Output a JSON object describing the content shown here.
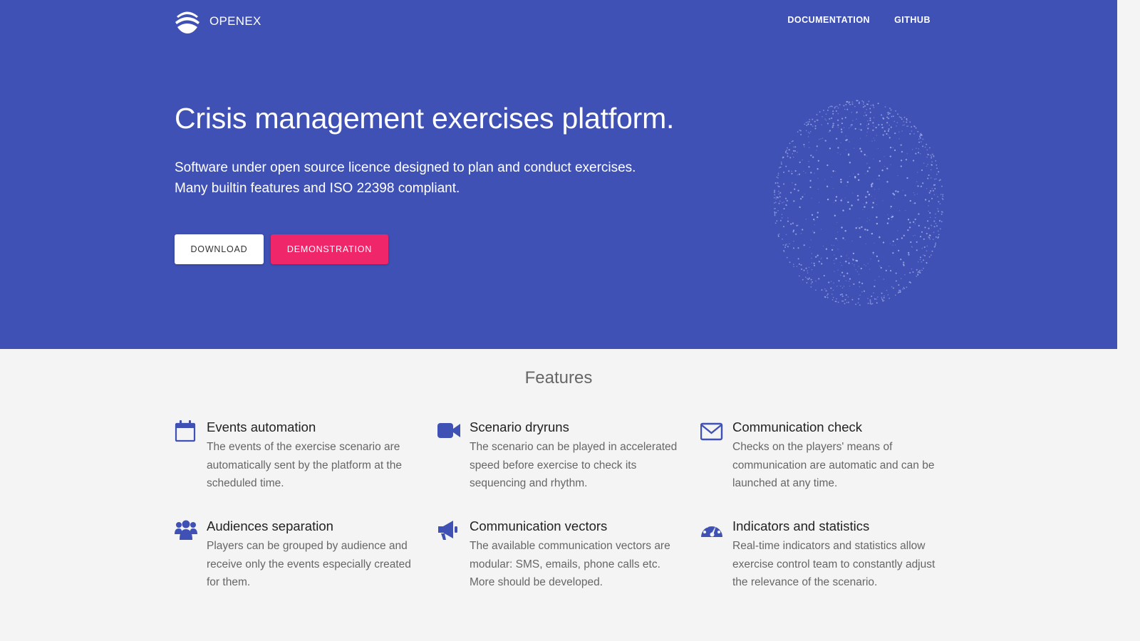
{
  "header": {
    "logo_text": "OPENEX",
    "nav": [
      "DOCUMENTATION",
      "GITHUB"
    ]
  },
  "hero": {
    "title": "Crisis management exercises platform.",
    "subtitle_line1": "Software under open source licence designed to plan and conduct exercises.",
    "subtitle_line2": "Many builtin features and ISO 22398 compliant.",
    "download_label": "DOWNLOAD",
    "demo_label": "DEMONSTRATION"
  },
  "features": {
    "title": "Features",
    "items": [
      {
        "icon": "calendar-icon",
        "title": "Events automation",
        "text": "The events of the exercise scenario are automatically sent by the platform at the scheduled time."
      },
      {
        "icon": "video-camera-icon",
        "title": "Scenario dryruns",
        "text": "The scenario can be played in accelerated speed before exercise to check its sequencing and rhythm."
      },
      {
        "icon": "envelope-icon",
        "title": "Communication check",
        "text": "Checks on the players' means of communication are automatic and can be launched at any time."
      },
      {
        "icon": "users-icon",
        "title": "Audiences separation",
        "text": "Players can be grouped by audience and receive only the events especially created for them."
      },
      {
        "icon": "megaphone-icon",
        "title": "Communication vectors",
        "text": "The available communication vectors are modular: SMS, emails, phone calls etc. More should be developed."
      },
      {
        "icon": "dashboard-gauge-icon",
        "title": "Indicators and statistics",
        "text": "Real-time indicators and statistics allow exercise control team to constantly adjust the relevance of the scenario."
      }
    ]
  },
  "colors": {
    "primary": "#3f51b5",
    "accent": "#f0266b",
    "background": "#f4f4f4"
  }
}
